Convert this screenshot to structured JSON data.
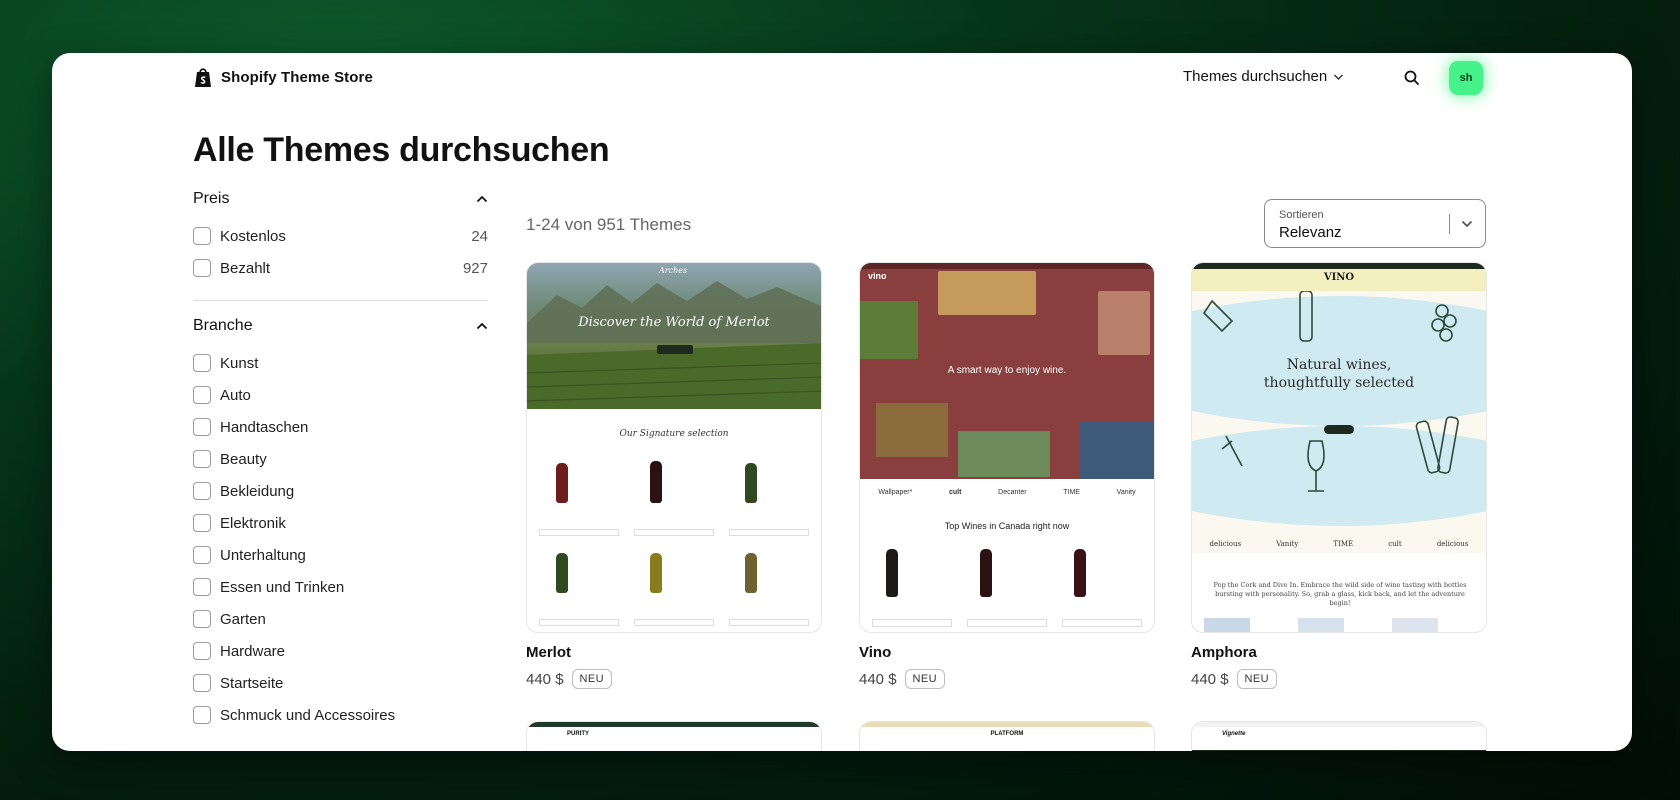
{
  "header": {
    "brand": "Shopify Theme Store",
    "nav_browse": "Themes durchsuchen",
    "avatar_initials": "sh"
  },
  "page_title": "Alle Themes durchsuchen",
  "filters": {
    "price": {
      "title": "Preis",
      "options": [
        {
          "label": "Kostenlos",
          "count": "24"
        },
        {
          "label": "Bezahlt",
          "count": "927"
        }
      ]
    },
    "industry": {
      "title": "Branche",
      "options": [
        {
          "label": "Kunst"
        },
        {
          "label": "Auto"
        },
        {
          "label": "Handtaschen"
        },
        {
          "label": "Beauty"
        },
        {
          "label": "Bekleidung"
        },
        {
          "label": "Elektronik"
        },
        {
          "label": "Unterhaltung"
        },
        {
          "label": "Essen und Trinken"
        },
        {
          "label": "Garten"
        },
        {
          "label": "Hardware"
        },
        {
          "label": "Startseite"
        },
        {
          "label": "Schmuck und Accessoires"
        }
      ]
    }
  },
  "results": {
    "count_text": "1-24 von 951 Themes",
    "sort_label": "Sortieren",
    "sort_value": "Relevanz"
  },
  "themes": [
    {
      "name": "Merlot",
      "price": "440 $",
      "badge": "NEU",
      "preview": {
        "hero": "Discover the World of Merlot",
        "section": "Our Signature selection",
        "logo": "Arches"
      }
    },
    {
      "name": "Vino",
      "price": "440 $",
      "badge": "NEU",
      "preview": {
        "logo": "vino",
        "hero": "A smart way to enjoy wine.",
        "press": [
          "Wallpaper*",
          "cult",
          "Decanter",
          "TIME",
          "Vanity"
        ],
        "section": "Top Wines in Canada right now"
      }
    },
    {
      "name": "Amphora",
      "price": "440 $",
      "badge": "NEU",
      "preview": {
        "logo": "VINO",
        "hero_line1": "Natural wines,",
        "hero_line2": "thoughtfully selected",
        "press": [
          "delicious",
          "Vanity",
          "TIME",
          "cult",
          "delicious"
        ],
        "body": "Pop the Cork and Dive In. Embrace the wild side of wine tasting with bottles bursting with personality. So, grab a glass, kick back, and let the adventure begin!"
      }
    }
  ],
  "next_row": [
    {
      "logo": "PURITY"
    },
    {
      "logo": "PLATFORM"
    },
    {
      "logo": "Vignette"
    }
  ],
  "colors": {
    "accent_green": "#46f28a",
    "vino_maroon": "#8a3f3f",
    "amphora_blue": "#cfeaf0",
    "amphora_yellow": "#f3efbf"
  }
}
